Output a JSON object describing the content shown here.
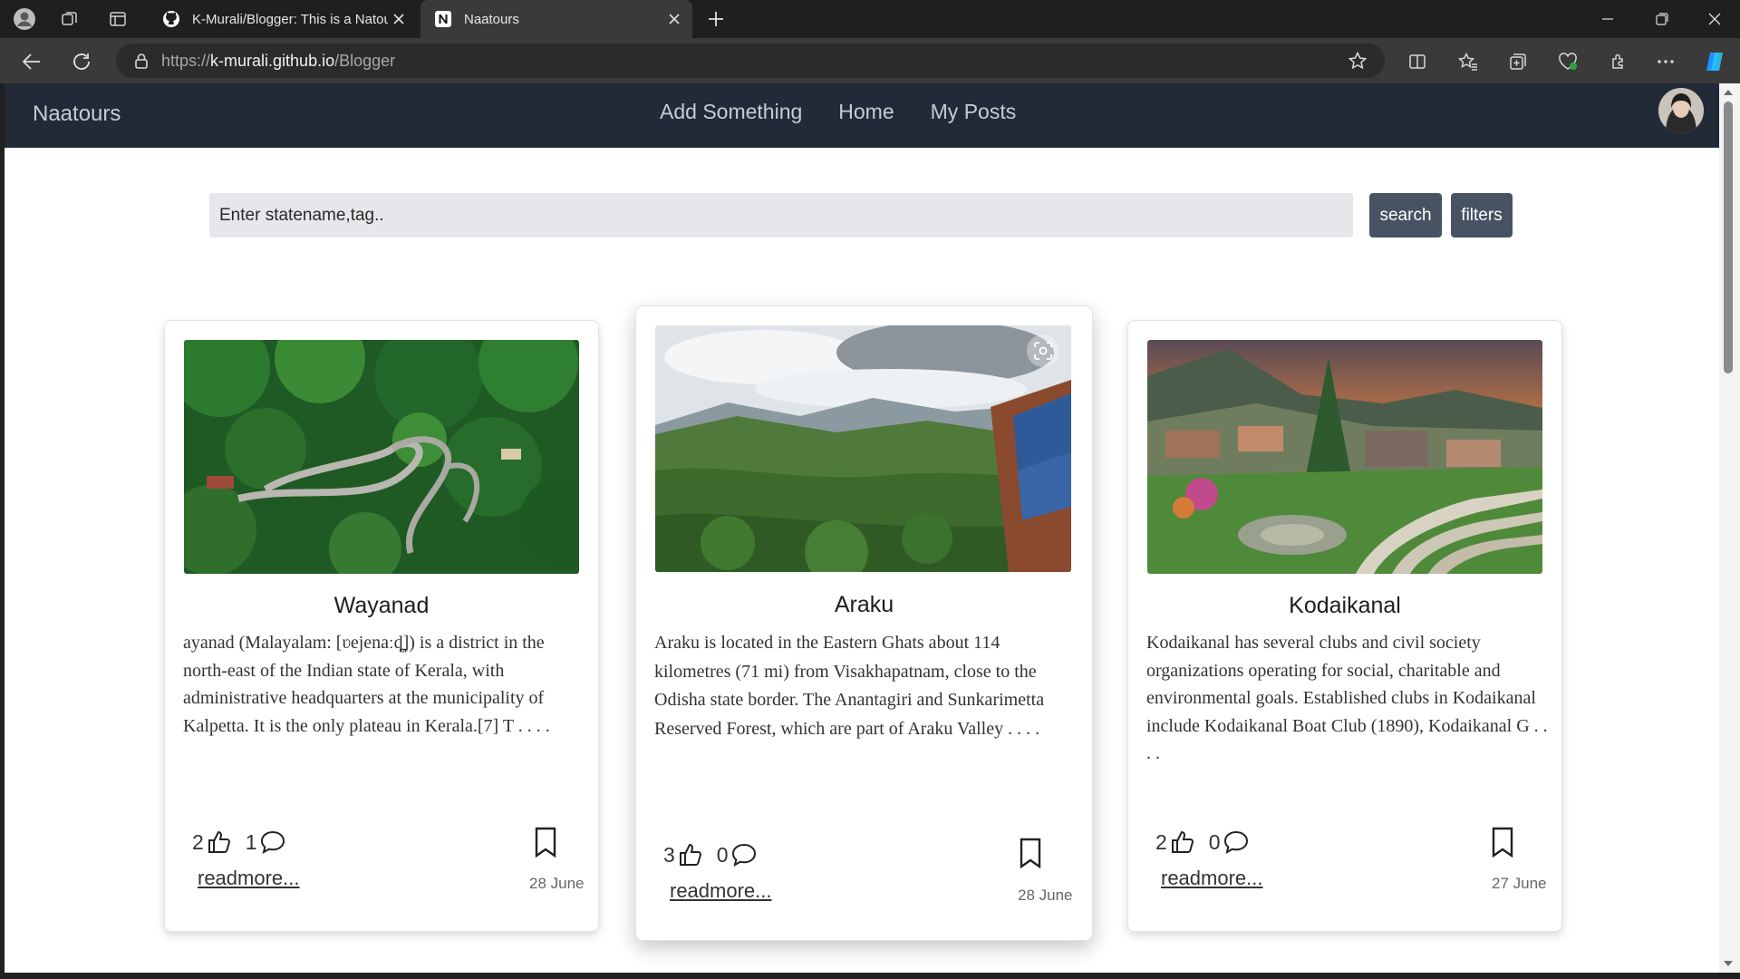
{
  "browser": {
    "tabs": [
      {
        "title": "K-Murali/Blogger: This is a Natou",
        "active": false
      },
      {
        "title": "Naatours",
        "active": true
      }
    ],
    "url_prefix": "https://",
    "url_host": "k-murali.github.io",
    "url_path": "/Blogger"
  },
  "navbar": {
    "brand": "Naatours",
    "links": [
      "Add Something",
      "Home",
      "My Posts"
    ]
  },
  "search": {
    "placeholder": "Enter statename,tag..",
    "search_label": "search",
    "filters_label": "filters"
  },
  "cards": [
    {
      "title": "Wayanad",
      "description": "ayanad (Malayalam: [ʋejenaːɖ̪]) is a district in the north-east of the Indian state of Kerala, with administrative headquarters at the municipality of Kalpetta. It is the only plateau in Kerala.[7] T . . . .",
      "likes": "2",
      "comments": "1",
      "readmore": "readmore...",
      "date": "28 June"
    },
    {
      "title": "Araku",
      "description": "Araku is located in the Eastern Ghats about 114 kilometres (71 mi) from Visakhapatnam, close to the Odisha state border. The Anantagiri and Sunkarimetta Reserved Forest, which are part of Araku Valley . . . .",
      "likes": "3",
      "comments": "0",
      "readmore": "readmore...",
      "date": "28 June"
    },
    {
      "title": "Kodaikanal",
      "description": "Kodaikanal has several clubs and civil society organizations operating for social, charitable and environmental goals. Established clubs in Kodaikanal include Kodaikanal Boat Club (1890), Kodaikanal G . . . .",
      "likes": "2",
      "comments": "0",
      "readmore": "readmore...",
      "date": "27 June"
    }
  ],
  "colors": {
    "navbar_bg": "#212a36",
    "button_bg": "#475363",
    "input_bg": "#e6e7ea"
  }
}
